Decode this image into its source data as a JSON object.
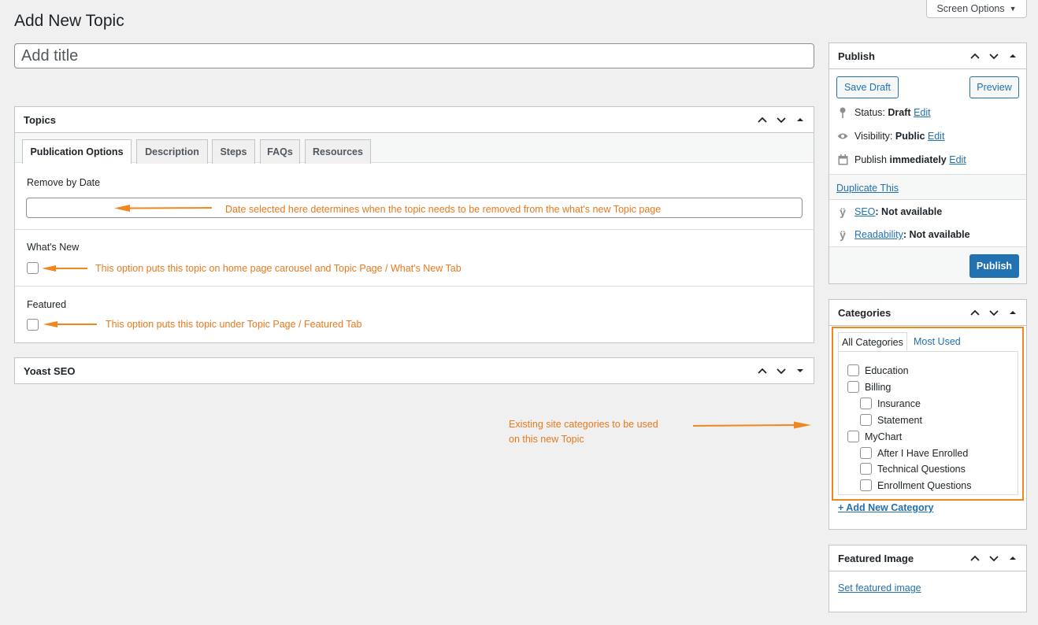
{
  "header": {
    "screen_options": "Screen Options",
    "page_title": "Add New Topic",
    "title_placeholder": "Add title"
  },
  "topics_box": {
    "title": "Topics",
    "tabs": [
      "Publication Options",
      "Description",
      "Steps",
      "FAQs",
      "Resources"
    ],
    "fields": {
      "remove_by_date": "Remove by Date",
      "whats_new": "What's New",
      "featured": "Featured"
    },
    "notes": {
      "date": "Date selected here determines when the topic needs to be removed from the what's new Topic page",
      "whats_new": "This option puts this topic on home page carousel and Topic Page / What's New Tab",
      "featured": "This option puts this topic under Topic Page / Featured Tab"
    }
  },
  "yoast_box": {
    "title": "Yoast SEO"
  },
  "categories_note": {
    "line1": "Existing site categories to be used",
    "line2": "on this new Topic"
  },
  "publish_box": {
    "title": "Publish",
    "save_draft": "Save Draft",
    "preview": "Preview",
    "status_label": "Status:",
    "status_value": "Draft",
    "visibility_label": "Visibility:",
    "visibility_value": "Public",
    "publish_label": "Publish",
    "publish_value": "immediately",
    "edit": "Edit",
    "duplicate": "Duplicate This",
    "seo_link": "SEO",
    "seo_value": ": Not available",
    "readability_link": "Readability",
    "readability_value": ": Not available",
    "publish_button": "Publish"
  },
  "categories_box": {
    "title": "Categories",
    "tab_all": "All Categories",
    "tab_most_used": "Most Used",
    "items": [
      "Education",
      "Billing",
      "Insurance",
      "Statement",
      "MyChart",
      "After I Have Enrolled",
      "Technical Questions",
      "Enrollment Questions"
    ],
    "add_new": "+ Add New Category"
  },
  "featured_image_box": {
    "title": "Featured Image",
    "set_link": "Set featured image"
  },
  "colors": {
    "accent": "#2271b1",
    "annotation": "#e8791d",
    "highlight_border": "#f0861e"
  }
}
